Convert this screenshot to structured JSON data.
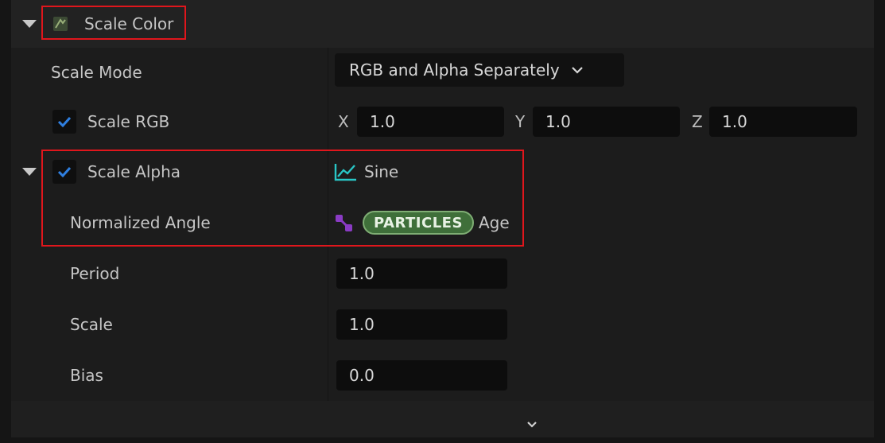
{
  "section": {
    "title": "Scale Color",
    "icon": "module-icon"
  },
  "rows": {
    "scale_mode": {
      "label": "Scale Mode",
      "value": "RGB and Alpha Separately"
    },
    "scale_rgb": {
      "label": "Scale RGB",
      "checked": true,
      "x_label": "X",
      "x": "1.0",
      "y_label": "Y",
      "y": "1.0",
      "z_label": "Z",
      "z": "1.0"
    },
    "scale_alpha": {
      "label": "Scale Alpha",
      "checked": true,
      "value": "Sine"
    },
    "normalized_angle": {
      "label": "Normalized Angle",
      "namespace": "PARTICLES",
      "attribute": "Age"
    },
    "period": {
      "label": "Period",
      "value": "1.0"
    },
    "scale": {
      "label": "Scale",
      "value": "1.0"
    },
    "bias": {
      "label": "Bias",
      "value": "0.0"
    }
  },
  "colors": {
    "highlight": "#e0161c",
    "checkmark": "#2f7fe0",
    "sine_icon": "#29c6c6",
    "particles_pill": "#3f6f3a",
    "link_icon": "#8a3bc4"
  }
}
